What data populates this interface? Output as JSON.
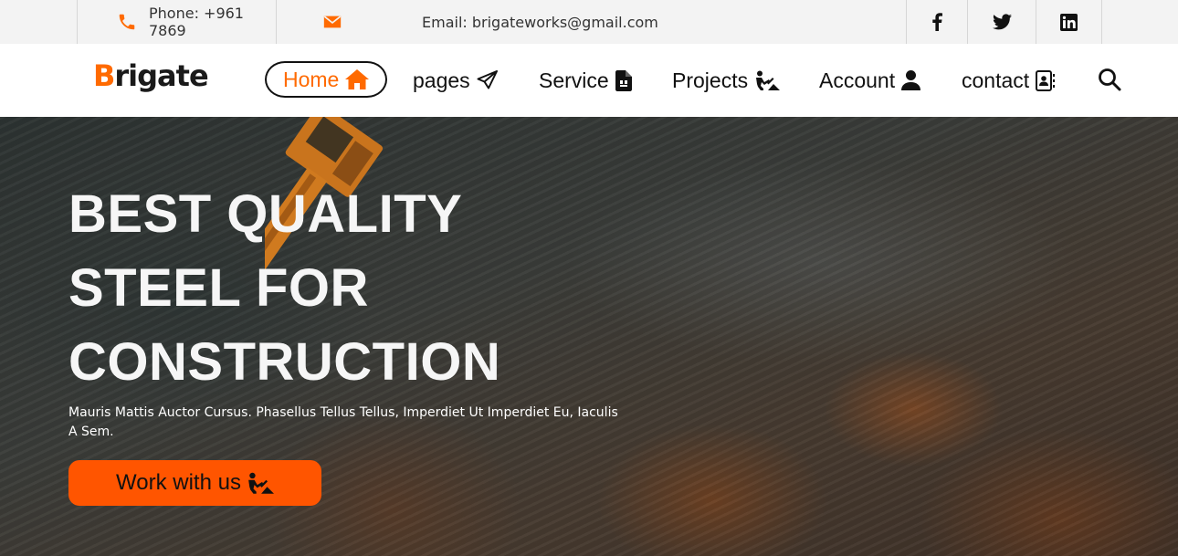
{
  "topbar": {
    "phone_label": "Phone: +961 7869",
    "email_label": "Email: brigateworks@gmail.com",
    "social": [
      "facebook-icon",
      "twitter-icon",
      "linkedin-icon"
    ]
  },
  "nav": {
    "logo_first": "B",
    "logo_rest": "rigate",
    "items": [
      {
        "label": "Home",
        "icon": "home-icon",
        "active": true
      },
      {
        "label": "pages",
        "icon": "paper-plane-icon"
      },
      {
        "label": "Service",
        "icon": "file-icon"
      },
      {
        "label": "Projects",
        "icon": "worker-icon"
      },
      {
        "label": "Account",
        "icon": "user-icon"
      },
      {
        "label": "contact",
        "icon": "contact-book-icon"
      }
    ],
    "search_icon": "search-icon"
  },
  "hero": {
    "title_lines": [
      "BEST QUALITY",
      "STEEL FOR",
      "CONSTRUCTION"
    ],
    "subtitle": "Mauris Mattis Auctor Cursus. Phasellus Tellus Tellus, Imperdiet Ut Imperdiet Eu, Iaculis A Sem.",
    "cta_label": "Work with us"
  },
  "colors": {
    "accent": "#ff6a00",
    "button": "#ff5500",
    "topbar_bg": "#f3f3f3"
  }
}
